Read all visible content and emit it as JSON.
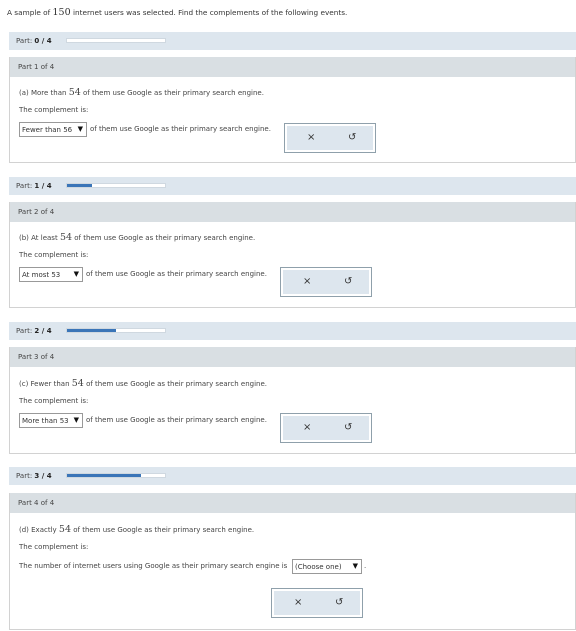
{
  "intro": {
    "before": "A sample of ",
    "number": "150",
    "after": " internet users was selected. Find the complements of the following events."
  },
  "parts": [
    {
      "progress_label": "Part:",
      "progress_value": "0 / 4",
      "progress_fraction": 0.0,
      "title": "Part 1 of 4",
      "question_before": "(a) More than ",
      "question_number": "54",
      "question_after": " of them use Google as their primary search engine.",
      "complement_label": "The complement is:",
      "select_prefix": "",
      "select_value": "Fewer than 56",
      "select_suffix": "of them use Google as their primary search engine.",
      "clear_icon": "close-icon",
      "undo_icon": "undo-icon"
    },
    {
      "progress_label": "Part:",
      "progress_value": "1 / 4",
      "progress_fraction": 0.25,
      "title": "Part 2 of 4",
      "question_before": "(b) At least ",
      "question_number": "54",
      "question_after": " of them use Google as their primary search engine.",
      "complement_label": "The complement is:",
      "select_prefix": "",
      "select_value": "At most 53",
      "select_suffix": "of them use Google as their primary search engine.",
      "clear_icon": "close-icon",
      "undo_icon": "undo-icon"
    },
    {
      "progress_label": "Part:",
      "progress_value": "2 / 4",
      "progress_fraction": 0.5,
      "title": "Part 3 of 4",
      "question_before": "(c) Fewer than ",
      "question_number": "54",
      "question_after": " of them use Google as their primary search engine.",
      "complement_label": "The complement is:",
      "select_prefix": "",
      "select_value": "More than 53",
      "select_suffix": "of them use Google as their primary search engine.",
      "clear_icon": "close-icon",
      "undo_icon": "undo-icon"
    },
    {
      "progress_label": "Part:",
      "progress_value": "3 / 4",
      "progress_fraction": 0.75,
      "title": "Part 4 of 4",
      "question_before": "(d) Exactly ",
      "question_number": "54",
      "question_after": " of them use Google as their primary search engine.",
      "complement_label": "The complement is:",
      "select_prefix": "The number of internet users using Google as their primary search engine is",
      "select_value": "(Choose one)",
      "select_suffix": ".",
      "clear_icon": "close-icon",
      "undo_icon": "undo-icon"
    }
  ],
  "glyphs": {
    "clear": "×",
    "undo": "↺",
    "arrow": "▼"
  },
  "colors": {
    "progress_fill": "#3a75b8",
    "bar_bg": "#dde6ee",
    "panel_header": "#d9dfe3"
  }
}
